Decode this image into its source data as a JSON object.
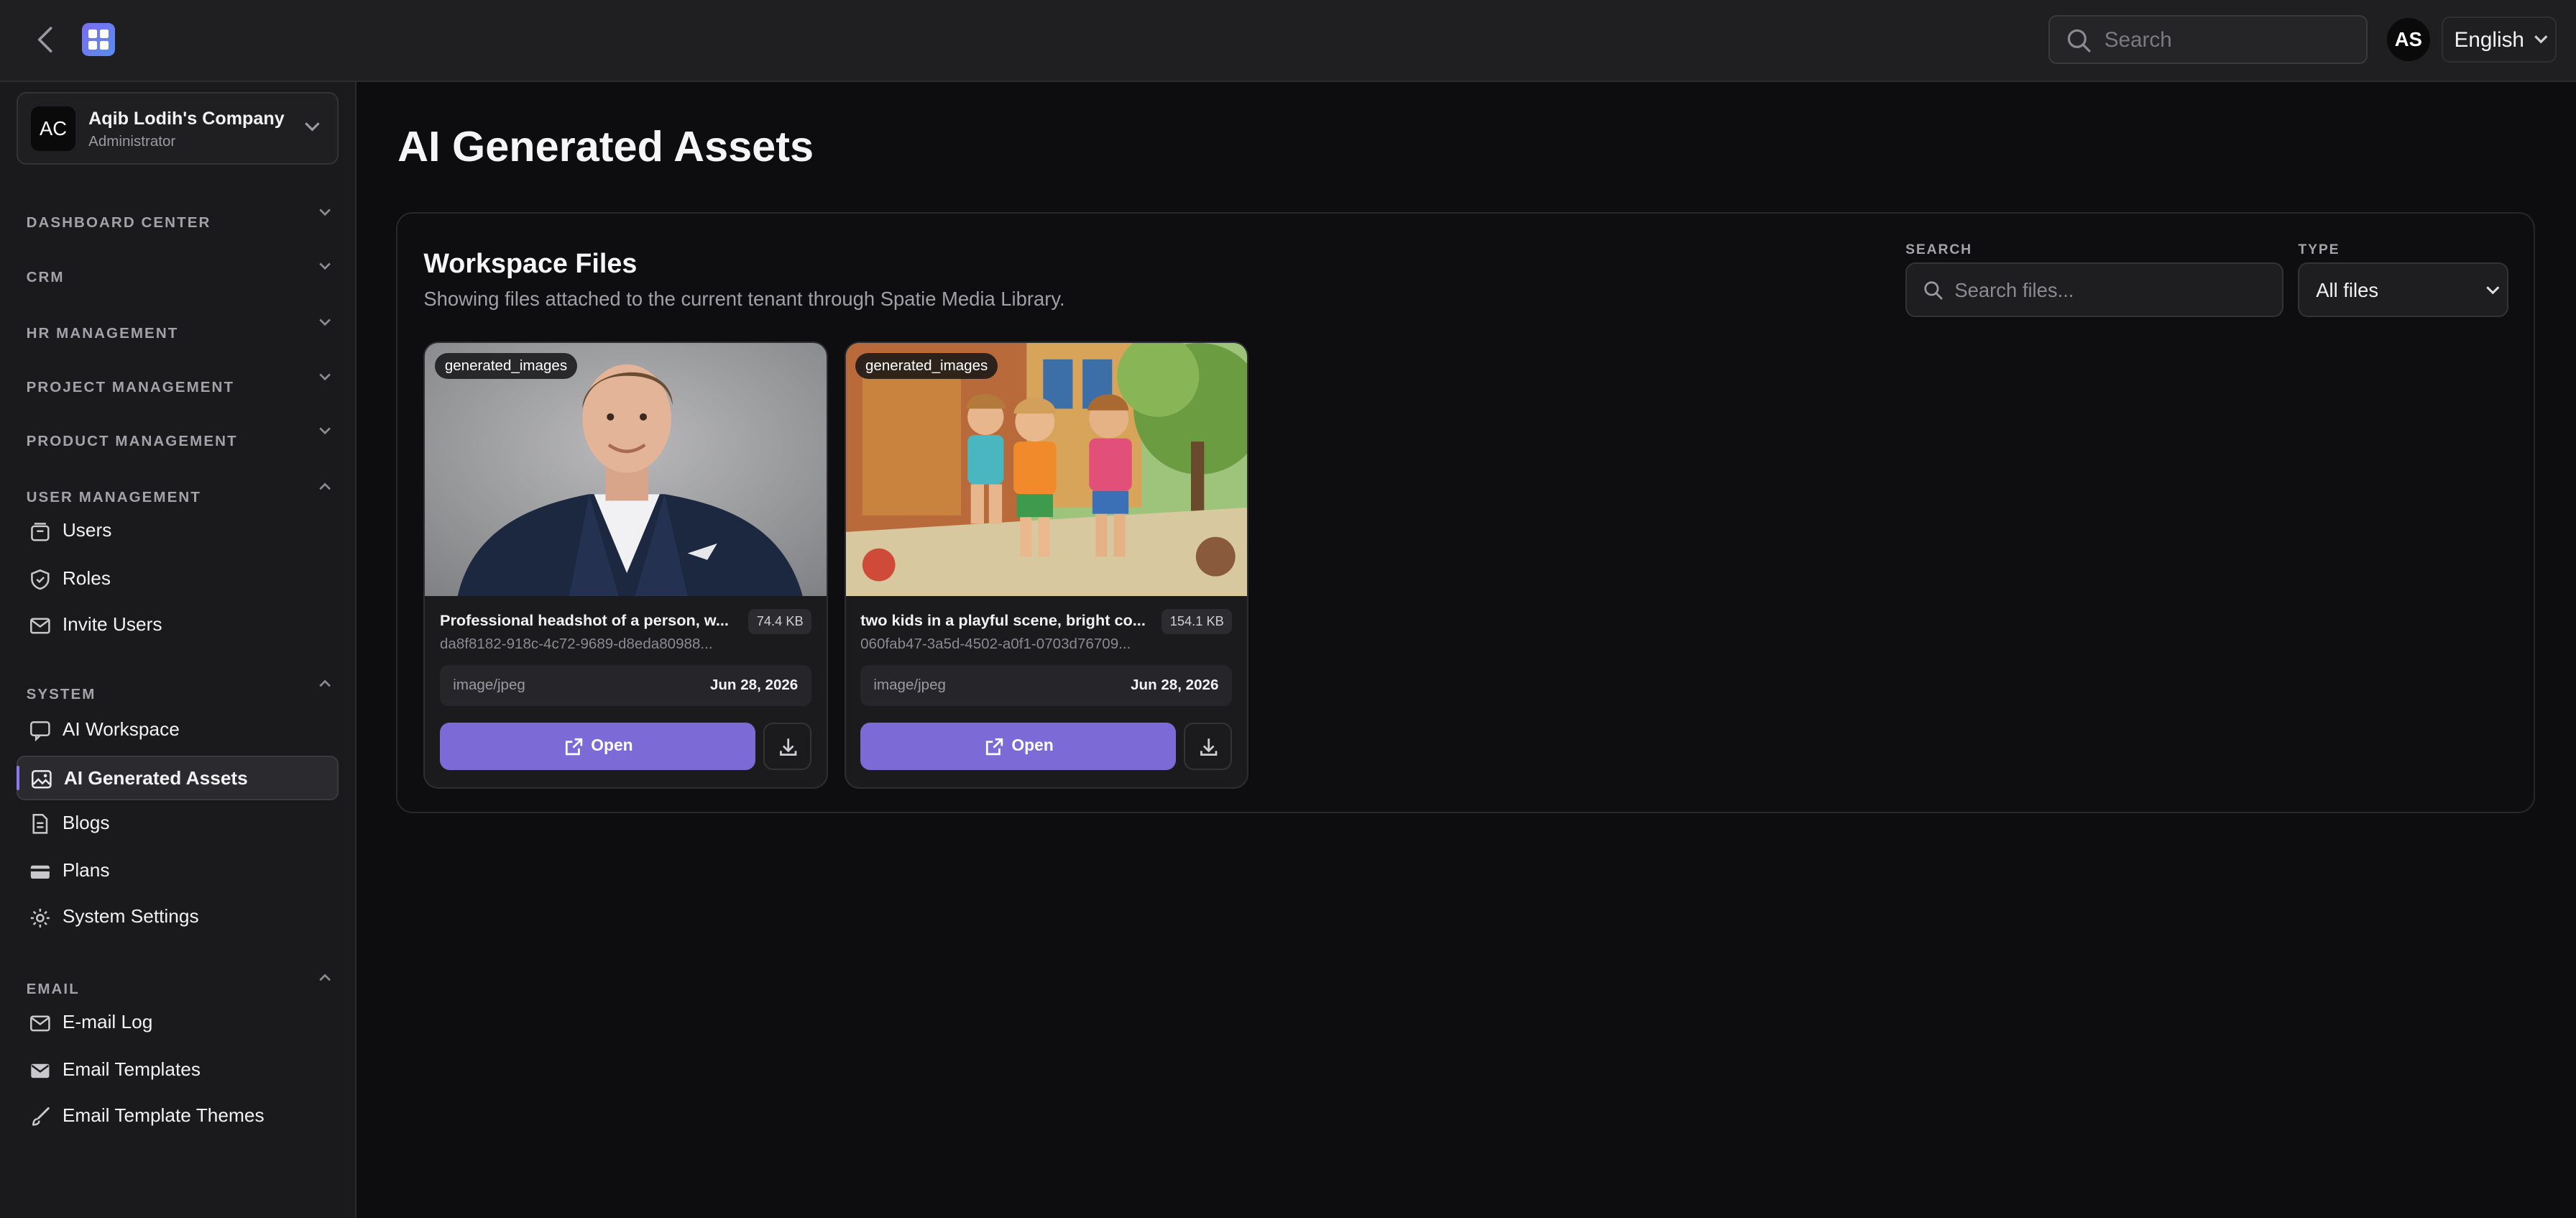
{
  "topbar": {
    "search_placeholder": "Search",
    "avatar_initials": "AS",
    "language": "English"
  },
  "sidebar": {
    "org_initials": "AC",
    "org_name": "Aqib Lodih's Company",
    "org_role": "Administrator",
    "sections": {
      "dashboard": "DASHBOARD CENTER",
      "crm": "CRM",
      "hr": "HR MANAGEMENT",
      "project": "PROJECT MANAGEMENT",
      "product": "PRODUCT MANAGEMENT",
      "user_mgmt": "USER MANAGEMENT",
      "system": "SYSTEM",
      "email": "EMAIL"
    },
    "items": {
      "users": "Users",
      "roles": "Roles",
      "invite_users": "Invite Users",
      "ai_workspace": "AI Workspace",
      "ai_generated_assets": "AI Generated Assets",
      "blogs": "Blogs",
      "plans": "Plans",
      "system_settings": "System Settings",
      "email_log": "E-mail Log",
      "email_templates": "Email Templates",
      "email_template_themes": "Email Template Themes"
    }
  },
  "main": {
    "page_title": "AI Generated Assets",
    "panel_title": "Workspace Files",
    "panel_subtitle": "Showing files attached to the current tenant through Spatie Media Library.",
    "search_label": "SEARCH",
    "search_placeholder": "Search files...",
    "type_label": "TYPE",
    "type_value": "All files",
    "files": [
      {
        "collection": "generated_images",
        "name": "Professional headshot of a person, w...",
        "size": "74.4 KB",
        "id": "da8f8182-918c-4c72-9689-d8eda80988...",
        "mime": "image/jpeg",
        "date": "Jun 28, 2026",
        "open_label": "Open"
      },
      {
        "collection": "generated_images",
        "name": "two kids in a playful scene, bright co...",
        "size": "154.1 KB",
        "id": "060fab47-3a5d-4502-a0f1-0703d76709...",
        "mime": "image/jpeg",
        "date": "Jun 28, 2026",
        "open_label": "Open"
      }
    ]
  }
}
